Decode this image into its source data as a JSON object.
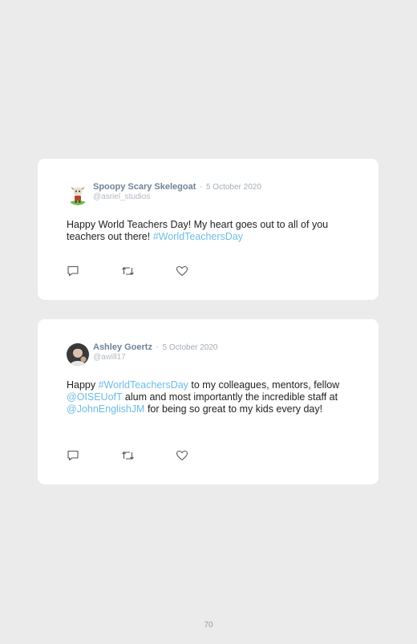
{
  "tweets": [
    {
      "display_name": "Spoopy Scary Skelegoat",
      "separator": "·",
      "date": "5 October 2020",
      "handle": "@asriel_studios",
      "text_parts": [
        "Happy World Teachers Day! My heart goes out to all of you teachers out there! ",
        "#WorldTeachersDay"
      ]
    },
    {
      "display_name": "Ashley Goertz",
      "separator": "·",
      "date": "5 October 2020",
      "handle": "@awill17",
      "text_parts": [
        "Happy ",
        "#WorldTeachersDay",
        " to my colleagues, mentors, fellow ",
        "@OISEUofT",
        " alum and most importantly the incredible staff at ",
        "@JohnEnglishJM",
        " for being so great to my kids every day!"
      ]
    }
  ],
  "actions": {
    "reply_icon": "reply-icon",
    "retweet_icon": "retweet-icon",
    "like_icon": "heart-icon"
  },
  "colors": {
    "background": "#ebebeb",
    "card": "#ffffff",
    "link": "#6cbde6",
    "name": "#6f8296"
  },
  "page_number": "70"
}
